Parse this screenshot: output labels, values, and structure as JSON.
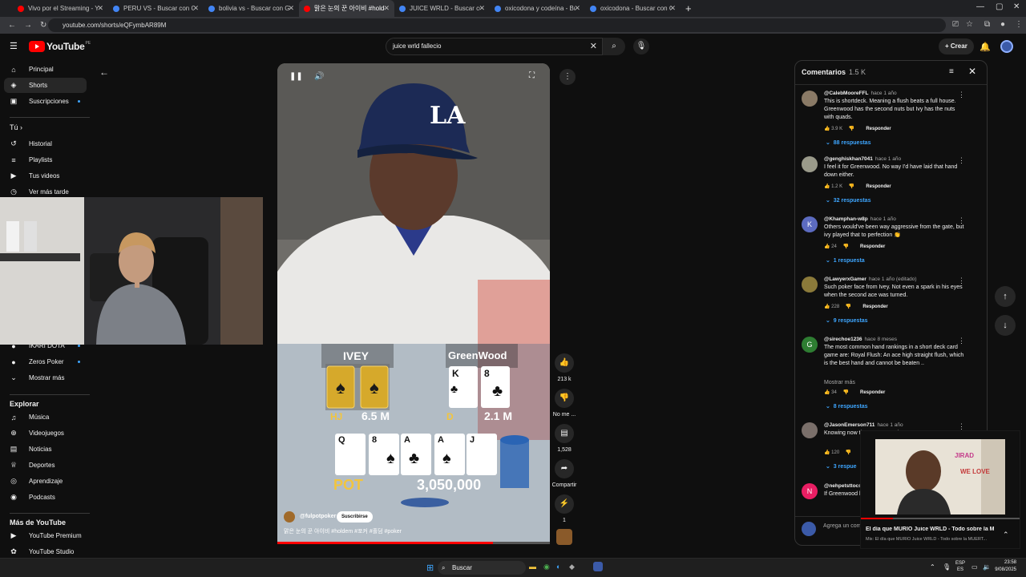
{
  "browser": {
    "tabs": [
      {
        "label": "Vivo por el Streaming - YouTube",
        "color": "#ff0000",
        "active": false
      },
      {
        "label": "PERU VS - Buscar con Google",
        "color": "#4285f4",
        "active": false
      },
      {
        "label": "bolivia vs - Buscar con Google",
        "color": "#4285f4",
        "active": false
      },
      {
        "label": "맑은 눈의 꾼 아이비 #holdem",
        "color": "#ff0000",
        "active": true
      },
      {
        "label": "JUICE WRLD - Buscar con Goog",
        "color": "#4285f4",
        "active": false
      },
      {
        "label": "oxicodona y codeína - Buscar c",
        "color": "#4285f4",
        "active": false
      },
      {
        "label": "oxicodona - Buscar con Google",
        "color": "#4285f4",
        "active": false
      }
    ],
    "url": "youtube.com/shorts/eQFymbAR89M"
  },
  "header": {
    "logo": "YouTube",
    "country": "PE",
    "search_value": "juice wrld fallecio",
    "create_label": "Crear"
  },
  "sidebar": {
    "main": [
      {
        "label": "Principal",
        "icon": "home-icon"
      },
      {
        "label": "Shorts",
        "icon": "shorts-icon"
      },
      {
        "label": "Suscripciones",
        "icon": "subscriptions-icon"
      }
    ],
    "you_label": "Tú",
    "you": [
      {
        "label": "Historial",
        "icon": "history-icon"
      },
      {
        "label": "Playlists",
        "icon": "playlist-icon"
      },
      {
        "label": "Tus videos",
        "icon": "video-icon"
      },
      {
        "label": "Ver más tarde",
        "icon": "clock-icon"
      }
    ],
    "subs": [
      {
        "label": "IKARI DOTA"
      },
      {
        "label": "Zeros Poker"
      }
    ],
    "show_more": "Mostrar más",
    "explore_label": "Explorar",
    "explore": [
      {
        "label": "Música",
        "icon": "music-icon"
      },
      {
        "label": "Videojuegos",
        "icon": "gamepad-icon"
      },
      {
        "label": "Noticias",
        "icon": "news-icon"
      },
      {
        "label": "Deportes",
        "icon": "trophy-icon"
      },
      {
        "label": "Aprendizaje",
        "icon": "bulb-icon"
      },
      {
        "label": "Podcasts",
        "icon": "podcast-icon"
      }
    ],
    "more_label": "Más de YouTube",
    "more": [
      {
        "label": "YouTube Premium"
      },
      {
        "label": "YouTube Studio"
      }
    ]
  },
  "video": {
    "player1_name": "IVEY",
    "player1_pos": "HJ",
    "player1_stack": "6.5 M",
    "player2_name": "GreenWood",
    "player2_pos": "D",
    "player2_stack": "2.1 M",
    "p2_cards": [
      "K",
      "8"
    ],
    "board": [
      "Q",
      "8",
      "A",
      "A",
      "J"
    ],
    "pot_label": "POT",
    "pot_value": "3,050,000",
    "channel": "@fulpotpoker",
    "subscribe": "Suscribirse",
    "caption": "맑은 눈의 꾼 아이비 #holdem #포커 #홀덤 #poker",
    "progress": 0.79
  },
  "actions": {
    "likes": "213 k",
    "dislike": "No me ...",
    "comments": "1,528",
    "share": "Compartir",
    "remix": "1"
  },
  "comments": {
    "title": "Comentarios",
    "count": "1.5 K",
    "items": [
      {
        "user": "@CalebMooreFFL",
        "time": "hace 1 año",
        "text": "This is shortdeck. Meaning a flush beats a full house. Greenwood has the second nuts but Ivy has the nuts with quads.",
        "likes": "3.9 K",
        "replies": "88 respuestas",
        "avatar_color": "#8a7a66",
        "initial": ""
      },
      {
        "user": "@genghiskhan7041",
        "time": "hace 1 año",
        "text": "I feel it for Greenwood. No way I'd have laid that hand down either.",
        "likes": "1.2 K",
        "replies": "32 respuestas",
        "avatar_color": "#9a9a8a",
        "initial": ""
      },
      {
        "user": "@Khamphan-w8p",
        "time": "hace 1 año",
        "text": "Others would've been way aggressive from the gate, but ivy played that to perfection 👏",
        "likes": "24",
        "replies": "1 respuesta",
        "avatar_color": "#5c6bc0",
        "initial": "K"
      },
      {
        "user": "@LawyerxGamer",
        "time": "hace 1 año (editado)",
        "text": "Such poker face from Ivey. Not even a spark in his eyes when the second ace was turned.",
        "likes": "228",
        "replies": "9 respuestas",
        "avatar_color": "#8b7a3a",
        "initial": ""
      },
      {
        "user": "@sirechoe1236",
        "time": "hace 8 meses",
        "text": "The most common hand rankings in a short deck card game are: Royal Flush: An ace high straight flush, which is the best hand and cannot be beaten ..",
        "show_more": "Mostrar más",
        "likes": "34",
        "replies": "8 respuestas",
        "avatar_color": "#2e7d32",
        "initial": "G"
      },
      {
        "user": "@JasonEmerson711",
        "time": "hace 1 año",
        "text": "Knowing now that Greenwood's c",
        "likes": "120",
        "replies": "3 respue",
        "avatar_color": "#7a6f6a",
        "initial": ""
      },
      {
        "user": "@nehpetsttocs",
        "time": "",
        "text": "If Greenwood had of the 8 it wou",
        "likes": "",
        "replies": "",
        "avatar_color": "#e91e63",
        "initial": "N"
      }
    ],
    "reply_label": "Responder",
    "add_placeholder": "Agrega un com"
  },
  "miniplayer": {
    "title": "El día que MURIÓ Juice WRLD - Todo sobre la M...",
    "subtitle": "Mix: El día que MURIÓ Juice WRLD - Todo sobre la MUERT...",
    "poster_text1": "JIRAD",
    "poster_text2": "WE LOVE"
  },
  "taskbar": {
    "search": "Buscar",
    "lang1": "ESP",
    "lang2": "ES",
    "time": "23:58",
    "date": "9/08/2025"
  }
}
